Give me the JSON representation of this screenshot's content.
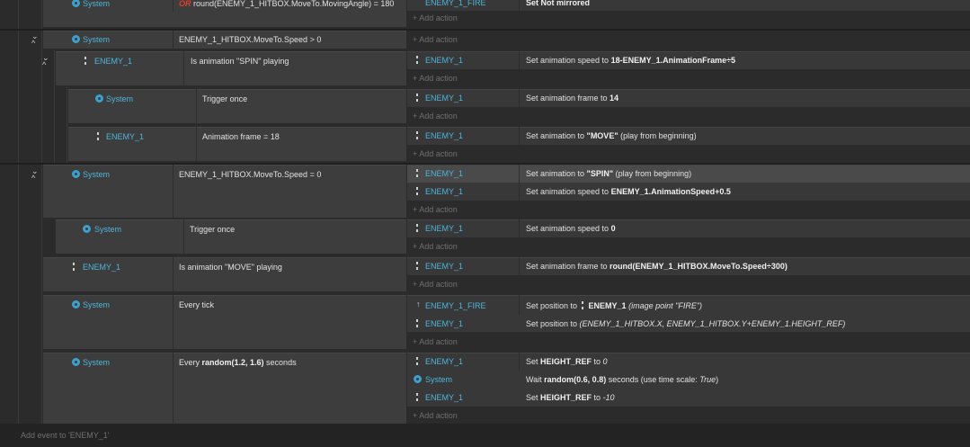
{
  "top": {
    "condition_obj": "System",
    "condition_or": "OR",
    "condition_text": "round(ENEMY_1_HITBOX.MoveTo.MovingAngle) = 180",
    "action_obj": "ENEMY_1_FIRE",
    "action_text": "Set Not mirrored",
    "add_action": "Add action"
  },
  "events": [
    {
      "cond_obj": "System",
      "cond_text": "ENEMY_1_HITBOX.MoveTo.Speed > 0",
      "add_action": "Add action"
    },
    {
      "cond_obj": "ENEMY_1",
      "cond_text": "Is animation \"SPIN\" playing",
      "act_obj": "ENEMY_1",
      "act_pre": "Set animation speed to ",
      "act_bold": "18-ENEMY_1.AnimationFrame÷5",
      "add_action": "Add action"
    },
    {
      "cond_obj": "System",
      "cond_text": "Trigger once",
      "act_obj": "ENEMY_1",
      "act_pre": "Set animation frame to ",
      "act_bold": "14",
      "add_action": "Add action"
    },
    {
      "cond_obj": "ENEMY_1",
      "cond_text": "Animation frame = 18",
      "act_obj": "ENEMY_1",
      "act_pre": "Set animation to ",
      "act_bold": "\"MOVE\"",
      "act_post": " (play from beginning)",
      "add_action": "Add action"
    },
    {
      "cond_obj": "System",
      "cond_text": "ENEMY_1_HITBOX.MoveTo.Speed = 0",
      "act1_obj": "ENEMY_1",
      "act1_pre": "Set animation to ",
      "act1_bold": "\"SPIN\"",
      "act1_post": " (play from beginning)",
      "act2_obj": "ENEMY_1",
      "act2_pre": "Set animation speed to ",
      "act2_bold": "ENEMY_1.AnimationSpeed+0.5",
      "add_action": "Add action"
    },
    {
      "cond_obj": "System",
      "cond_text": "Trigger once",
      "act_obj": "ENEMY_1",
      "act_pre": "Set animation speed to ",
      "act_bold": "0",
      "add_action": "Add action"
    },
    {
      "cond_obj": "ENEMY_1",
      "cond_text": "Is animation \"MOVE\" playing",
      "act_obj": "ENEMY_1",
      "act_pre": "Set animation frame to ",
      "act_bold": "round(ENEMY_1_HITBOX.MoveTo.Speed÷300)",
      "add_action": "Add action"
    },
    {
      "cond_obj": "System",
      "cond_text": "Every tick",
      "act1_obj": "ENEMY_1_FIRE",
      "act1_pre": "Set position to ",
      "act1_obj_inline": "ENEMY_1",
      "act1_italic": "(image point \"FIRE\")",
      "act2_obj": "ENEMY_1",
      "act2_pre": "Set position to ",
      "act2_italic": "(ENEMY_1_HITBOX.X, ENEMY_1_HITBOX.Y+ENEMY_1.HEIGHT_REF)",
      "add_action": "Add action"
    },
    {
      "cond_obj": "System",
      "cond_pre": "Every ",
      "cond_bold": "random(1.2, 1.6)",
      "cond_post": " seconds",
      "act1_obj": "ENEMY_1",
      "act1_pre": "Set ",
      "act1_bold": "HEIGHT_REF",
      "act1_mid": " to ",
      "act1_italic": "0",
      "act2_obj": "System",
      "act2_pre": "Wait ",
      "act2_bold": "random(0.6, 0.8)",
      "act2_mid": " seconds (use time scale: ",
      "act2_italic": "True",
      "act2_post": ")",
      "act3_obj": "ENEMY_1",
      "act3_pre": "Set ",
      "act3_bold": "HEIGHT_REF",
      "act3_mid": " to ",
      "act3_italic": "-10",
      "add_action": "Add action"
    }
  ],
  "footer": {
    "add_event": "Add event to 'ENEMY_1'"
  }
}
